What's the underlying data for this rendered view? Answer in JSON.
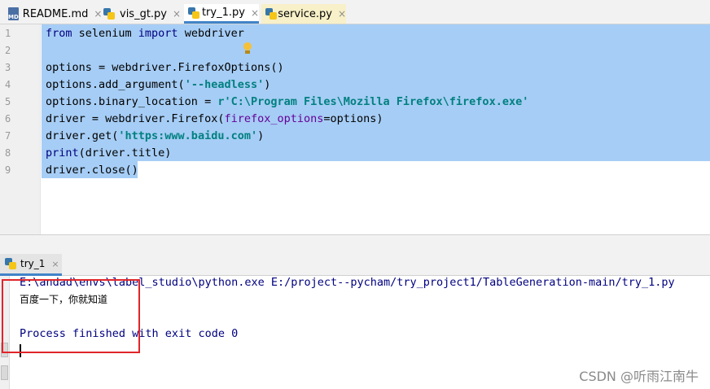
{
  "editor_tabs": [
    {
      "label": "README.md",
      "icon": "markdown-file-icon",
      "icon_text": "MD"
    },
    {
      "label": "vis_gt.py",
      "icon": "python-file-icon"
    },
    {
      "label": "try_1.py",
      "icon": "python-file-icon",
      "active": true
    },
    {
      "label": "service.py",
      "icon": "python-file-icon"
    }
  ],
  "tab_close_glyph": "×",
  "line_numbers": [
    "1",
    "2",
    "3",
    "4",
    "5",
    "6",
    "7",
    "8",
    "9"
  ],
  "code": {
    "l1_kw1": "from",
    "l1_mid": " selenium ",
    "l1_kw2": "import",
    "l1_end": " webdriver",
    "l3": "options = webdriver.FirefoxOptions()",
    "l4_a": "options.add_argument(",
    "l4_s": "'--headless'",
    "l4_b": ")",
    "l5_a": "options.binary_location = ",
    "l5_s": "r'C:\\Program Files\\Mozilla Firefox\\firefox.exe'",
    "l6_a": "driver = webdriver.Firefox(",
    "l6_p": "firefox_options",
    "l6_b": "=options)",
    "l7_a": "driver.get(",
    "l7_s": "'https:www.baidu.com'",
    "l7_b": ")",
    "l8_bi": "print",
    "l8_rest": "(driver.title)",
    "l9": "driver.close()"
  },
  "run_panel": {
    "tab_label": "try_1",
    "lines": {
      "command": "E:\\andad\\envs\\label_studio\\python.exe E:/project--pycham/try_project1/TableGeneration-main/try_1.py",
      "output": "百度一下，你就知道",
      "finished": "Process finished with exit code 0"
    }
  },
  "watermark": "CSDN @听雨江南牛",
  "colors": {
    "selection": "#a6cdf5",
    "keyword": "#000080",
    "string": "#008080",
    "highlight_box": "#e0252a",
    "active_tab_underline": "#4083c9"
  }
}
